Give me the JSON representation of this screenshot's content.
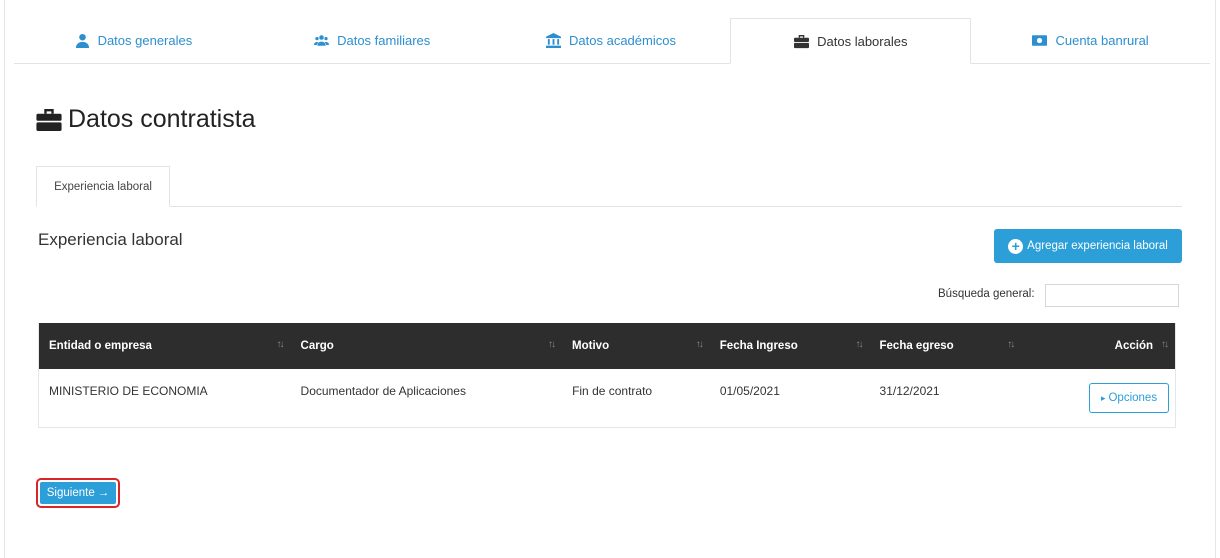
{
  "tabs": [
    {
      "label": "Datos generales",
      "icon": "user-icon",
      "active": false
    },
    {
      "label": "Datos familiares",
      "icon": "users-icon",
      "active": false
    },
    {
      "label": "Datos académicos",
      "icon": "university-icon",
      "active": false
    },
    {
      "label": "Datos laborales",
      "icon": "briefcase-icon",
      "active": true
    },
    {
      "label": "Cuenta banrural",
      "icon": "money-icon",
      "active": false
    }
  ],
  "section": {
    "title": "Datos contratista",
    "icon": "briefcase-icon"
  },
  "subtab": {
    "label": "Experiencia laboral"
  },
  "panel": {
    "title": "Experiencia laboral",
    "add_button": "Agregar experiencia laboral",
    "search_label": "Búsqueda general:",
    "search_value": ""
  },
  "table": {
    "headers": [
      "Entidad o empresa",
      "Cargo",
      "Motivo",
      "Fecha Ingreso",
      "Fecha egreso",
      "Acción"
    ],
    "rows": [
      [
        "MINISTERIO DE ECONOMIA",
        "Documentador de Aplicaciones",
        "Fin de contrato",
        "01/05/2021",
        "31/12/2021"
      ]
    ],
    "options_label": "Opciones"
  },
  "footer": {
    "next_label": "Siguiente"
  },
  "colors": {
    "accent": "#2c9fd9",
    "header_bg": "#2d2d2d",
    "highlight": "#d9242a"
  }
}
